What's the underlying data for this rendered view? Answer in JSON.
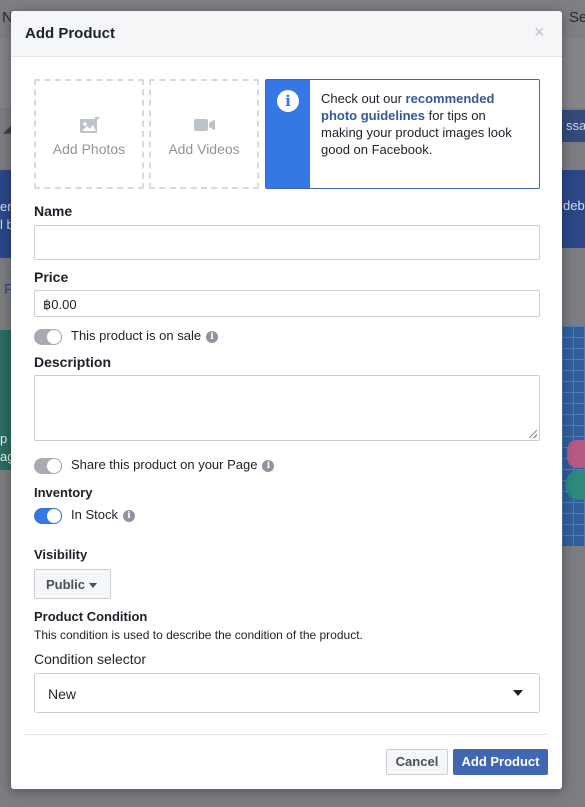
{
  "background": {
    "top_left_text": "N",
    "top_right_text": "Se",
    "message_button": "ssag",
    "left_banner_text": "er\nl b",
    "right_banner_text": "debi",
    "left_link_letter": "F",
    "left_promo_text": "p\nag"
  },
  "modal": {
    "title": "Add Product",
    "close_label": "×",
    "media": {
      "photos_label": "Add Photos",
      "videos_label": "Add Videos"
    },
    "tip": {
      "prefix": "Check out our ",
      "link_text": "recommended photo guidelines",
      "suffix": " for tips on making your product images look good on Facebook."
    },
    "name": {
      "label": "Name",
      "value": ""
    },
    "price": {
      "label": "Price",
      "value": "฿0.00"
    },
    "sale_toggle": {
      "label": "This product is on sale",
      "on": false
    },
    "description": {
      "label": "Description",
      "value": ""
    },
    "share_toggle": {
      "label": "Share this product on your Page",
      "on": false
    },
    "inventory": {
      "label": "Inventory",
      "in_stock_label": "In Stock",
      "in_stock_on": true
    },
    "visibility": {
      "label": "Visibility",
      "selected": "Public"
    },
    "condition": {
      "title": "Product Condition",
      "description": "This condition is used to describe the condition of the product.",
      "selector_label": "Condition selector",
      "selected": "New"
    },
    "buttons": {
      "cancel": "Cancel",
      "submit": "Add Product"
    }
  },
  "colors": {
    "primary": "#4267b2",
    "info_blue": "#3578e5",
    "link": "#365899",
    "text": "#1d2129",
    "muted": "#90949c"
  }
}
